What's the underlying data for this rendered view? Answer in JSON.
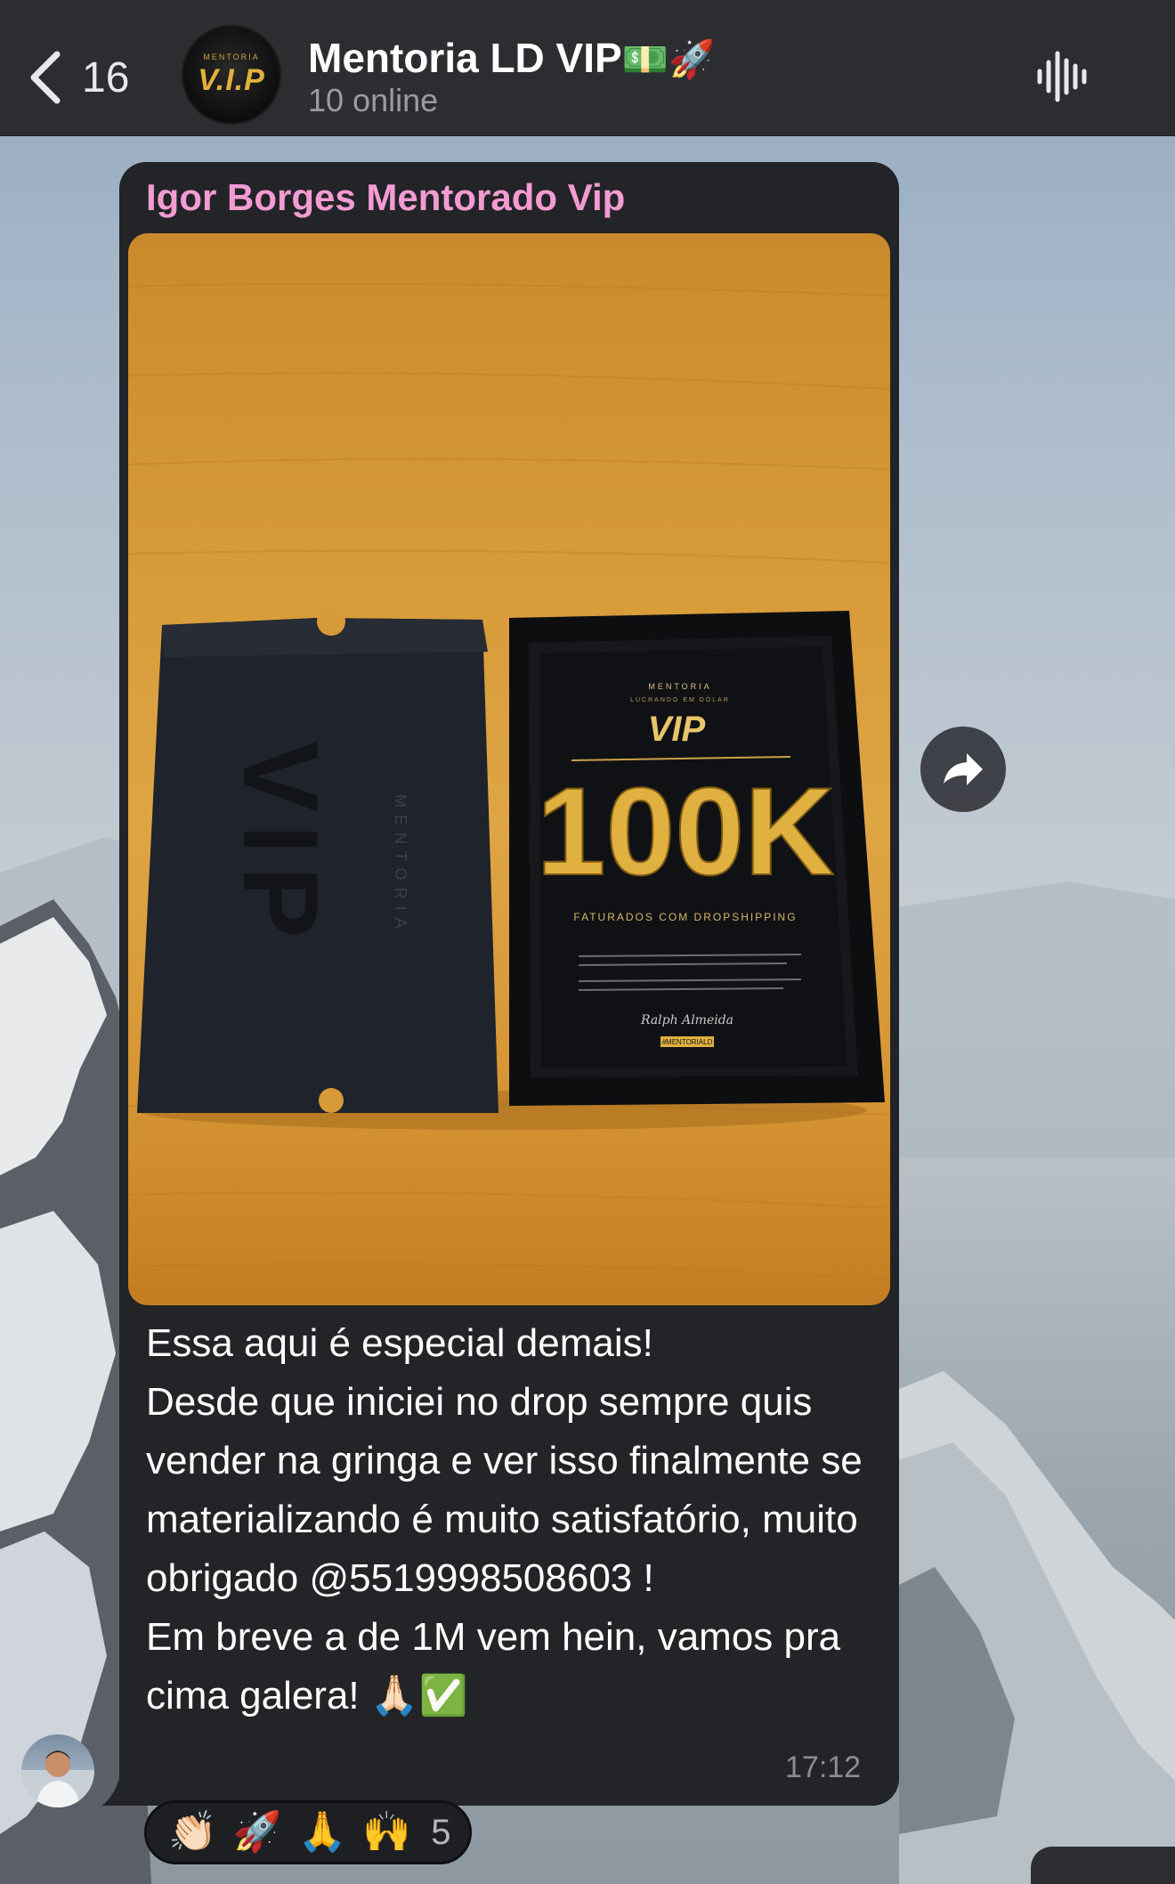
{
  "header": {
    "back_count": "16",
    "title": "Mentoria LD VIP",
    "title_emojis": "💵🚀",
    "subtitle": "10 online",
    "avatar_small": "MENTORIA",
    "avatar_text": "V.I.P"
  },
  "message": {
    "sender": "Igor Borges Mentorado Vip",
    "lines": [
      "Essa aqui é especial demais!",
      "Desde que iniciei no drop sempre quis vender na gringa e ver isso finalmente se materializando é muito satisfatório, muito obrigado @5519998508603 !",
      "Em breve a de 1M vem hein, vamos pra cima galera! 🙏🏻✅"
    ],
    "time": "17:12"
  },
  "photo": {
    "box_label": "VIP",
    "box_side_label": "MENTORIA",
    "plaque_top": "MENTORIA",
    "plaque_sub": "LUCRANDO EM DÓLAR",
    "plaque_vip": "VIP",
    "plaque_amount": "100K",
    "plaque_caption": "FATURADOS COM DROPSHIPPING",
    "plaque_signature": "Ralph Almeida",
    "plaque_tag": "#MENTORIALD"
  },
  "reactions": {
    "emojis": [
      "👏🏻",
      "🚀",
      "🙏",
      "🙌"
    ],
    "count": "5"
  },
  "colors": {
    "header_bg": "#2b2d31",
    "bubble_bg": "#232427",
    "sender_name": "#f39bd2",
    "avatar_gold": "#e2b13c"
  },
  "icons": {
    "back": "chevron-left-icon",
    "call": "voice-chat-icon",
    "forward": "forward-arrow-icon"
  }
}
